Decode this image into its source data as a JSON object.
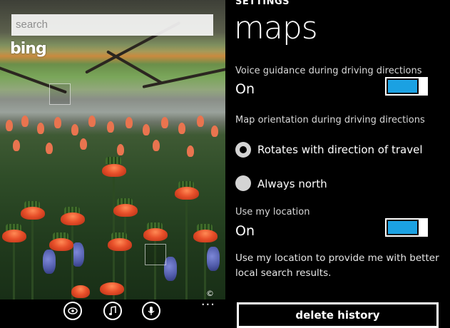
{
  "search": {
    "placeholder": "search"
  },
  "brand": {
    "logo_text": "bing"
  },
  "image_credit": "©",
  "appbar": {
    "buttons": [
      {
        "icon": "eye-icon"
      },
      {
        "icon": "music-note-icon"
      },
      {
        "icon": "microphone-icon"
      }
    ],
    "more": "..."
  },
  "settings": {
    "section": "SETTINGS",
    "title": "maps",
    "voice_guidance": {
      "label": "Voice guidance during driving directions",
      "state": "On"
    },
    "orientation": {
      "label": "Map orientation during driving directions",
      "options": [
        {
          "label": "Rotates with direction of travel",
          "selected": true
        },
        {
          "label": "Always north",
          "selected": false
        }
      ]
    },
    "location": {
      "label": "Use my location",
      "state": "On"
    },
    "location_desc": "Use my location to provide me with better local search results.",
    "delete_history": "delete history"
  },
  "colors": {
    "accent": "#1ba1e2",
    "background": "#000000",
    "text": "#ffffff"
  }
}
